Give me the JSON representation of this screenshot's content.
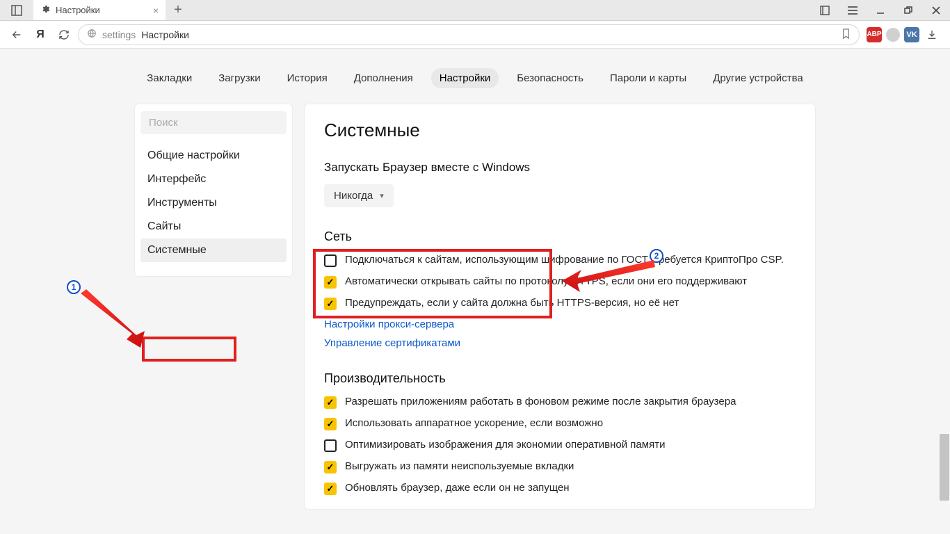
{
  "titlebar": {
    "tab_title": "Настройки"
  },
  "addressbar": {
    "prefix": "settings",
    "page": "Настройки"
  },
  "ext": {
    "abp": "ABP",
    "vk": "VK"
  },
  "topnav": [
    {
      "label": "Закладки"
    },
    {
      "label": "Загрузки"
    },
    {
      "label": "История"
    },
    {
      "label": "Дополнения"
    },
    {
      "label": "Настройки",
      "active": true
    },
    {
      "label": "Безопасность"
    },
    {
      "label": "Пароли и карты"
    },
    {
      "label": "Другие устройства"
    }
  ],
  "sidebar": {
    "search_placeholder": "Поиск",
    "items": [
      {
        "label": "Общие настройки"
      },
      {
        "label": "Интерфейс"
      },
      {
        "label": "Инструменты"
      },
      {
        "label": "Сайты"
      },
      {
        "label": "Системные",
        "active": true
      }
    ]
  },
  "main": {
    "title": "Системные",
    "startup": {
      "title": "Запускать Браузер вместе с Windows",
      "value": "Никогда"
    },
    "network": {
      "title": "Сеть",
      "cb1": {
        "checked": false,
        "label": "Подключаться к сайтам, использующим шифрование по ГОСТ. Требуется КриптоПро CSP."
      },
      "cb2": {
        "checked": true,
        "label": "Автоматически открывать сайты по протоколу HTTPS, если они его поддерживают"
      },
      "cb3": {
        "checked": true,
        "label": "Предупреждать, если у сайта должна быть HTTPS-версия, но её нет"
      },
      "link1": "Настройки прокси-сервера",
      "link2": "Управление сертификатами"
    },
    "perf": {
      "title": "Производительность",
      "cb1": {
        "checked": true,
        "label": "Разрешать приложениям работать в фоновом режиме после закрытия браузера"
      },
      "cb2": {
        "checked": true,
        "label": "Использовать аппаратное ускорение, если возможно"
      },
      "cb3": {
        "checked": false,
        "label": "Оптимизировать изображения для экономии оперативной памяти"
      },
      "cb4": {
        "checked": true,
        "label": "Выгружать из памяти неиспользуемые вкладки"
      },
      "cb5": {
        "checked": true,
        "label": "Обновлять браузер, даже если он не запущен"
      }
    }
  },
  "markers": {
    "m1": "1",
    "m2": "2"
  }
}
